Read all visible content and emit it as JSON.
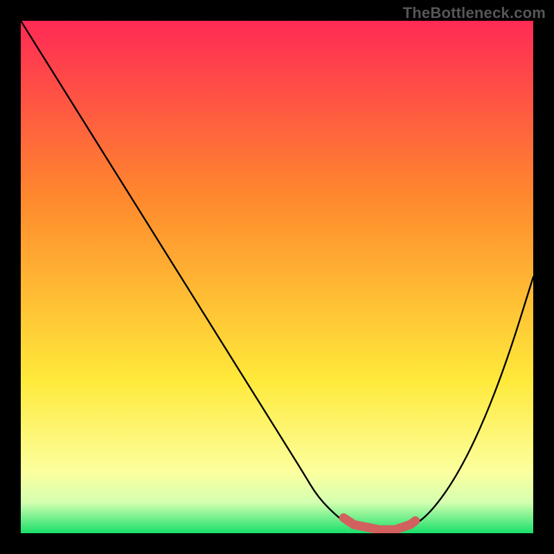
{
  "watermark": "TheBottleneck.com",
  "colors": {
    "grad_top": "#ff2a55",
    "grad_mid1": "#ff8a2d",
    "grad_mid2": "#ffe93a",
    "grad_low": "#fcff9e",
    "grad_band_light": "#d4ffb0",
    "grad_bottom": "#18e06a",
    "frame": "#000000",
    "curve": "#000000",
    "highlight": "#d2605e"
  },
  "chart_data": {
    "type": "line",
    "title": "",
    "xlabel": "",
    "ylabel": "",
    "xlim": [
      0,
      100
    ],
    "ylim": [
      0,
      100
    ],
    "grid": false,
    "legend": false,
    "series": [
      {
        "name": "bottleneck-curve",
        "x": [
          0,
          5,
          10,
          15,
          20,
          25,
          30,
          35,
          40,
          45,
          50,
          55,
          58,
          62,
          65,
          70,
          73,
          76,
          80,
          85,
          90,
          95,
          100
        ],
        "y": [
          100,
          92,
          84,
          76,
          68,
          60,
          52,
          44,
          36,
          28,
          20,
          12,
          7,
          3,
          1,
          0,
          0,
          1,
          4,
          11,
          21,
          34,
          50
        ]
      }
    ],
    "annotations": [
      {
        "name": "optimal-band",
        "x_range": [
          63,
          77
        ],
        "y": 0
      }
    ]
  }
}
